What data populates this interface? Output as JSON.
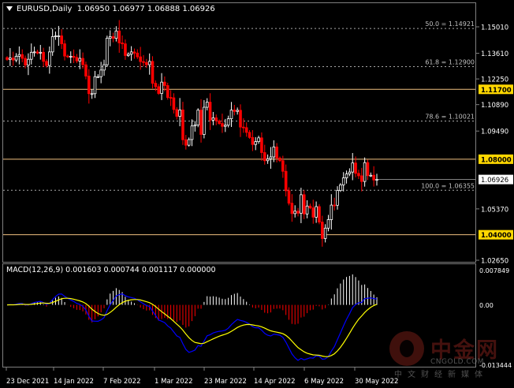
{
  "header": {
    "symbol": "EURUSD,Daily",
    "ohlc": "1.06950 1.06977 1.06888 1.06926"
  },
  "macd": {
    "title": "MACD(12,26,9) 0.001603 0.000744 0.001117 0.000000",
    "axis_labels": [
      "0.007849",
      "0.00",
      "-0.013444"
    ]
  },
  "price_axis": {
    "labels": [
      "1.15010",
      "1.13610",
      "1.12250",
      "1.10890",
      "1.09490",
      "1.05370",
      "1.02650"
    ],
    "current_price": "1.06926",
    "level_tags": [
      "1.11700",
      "1.08000",
      "1.04000"
    ]
  },
  "fib_levels": [
    {
      "label": "50.0 = 1.14921",
      "value": 1.14921
    },
    {
      "label": "61.8 = 1.12900",
      "value": 1.129
    },
    {
      "label": "78.6 = 1.10021",
      "value": 1.10021
    },
    {
      "label": "100.0 = 1.06355",
      "value": 1.06355
    }
  ],
  "horizontal_levels": [
    1.117,
    1.08,
    1.04
  ],
  "time_axis": [
    "23 Dec 2021",
    "14 Jan 2022",
    "7 Feb 2022",
    "1 Mar 2022",
    "23 Mar 2022",
    "14 Apr 2022",
    "6 May 2022",
    "30 May 2022"
  ],
  "colors": {
    "bull": "#ffffff",
    "bear": "#ff0000",
    "fib": "#a8a8a8",
    "level": "#f0c080",
    "signal": "#ffff00",
    "macd_line": "#0000ff",
    "hist_pos": "#ffffff",
    "hist_neg": "#ff0000",
    "tag_bg": "#ffd700"
  },
  "watermark": {
    "brand": "中金网",
    "domain": "CNGOLD.COM",
    "slogan": "中文财经新媒体"
  },
  "chart_data": {
    "type": "candlestick",
    "symbol": "EURUSD",
    "timeframe": "Daily",
    "closes": [
      1.1328,
      1.1336,
      1.1325,
      1.1345,
      1.1354,
      1.1334,
      1.1298,
      1.1329,
      1.1366,
      1.1368,
      1.1362,
      1.1366,
      1.1318,
      1.1296,
      1.1368,
      1.1449,
      1.1453,
      1.1453,
      1.1411,
      1.1346,
      1.1343,
      1.1345,
      1.1339,
      1.132,
      1.1334,
      1.13,
      1.124,
      1.1147,
      1.1147,
      1.1237,
      1.1237,
      1.1272,
      1.13,
      1.1441,
      1.1449,
      1.144,
      1.1479,
      1.1416,
      1.1411,
      1.1349,
      1.1356,
      1.1368,
      1.1362,
      1.1342,
      1.1317,
      1.1312,
      1.13,
      1.1318,
      1.1202,
      1.1184,
      1.1148,
      1.1208,
      1.119,
      1.1127,
      1.1125,
      1.1063,
      1.1027,
      1.1061,
      1.0903,
      1.0874,
      1.0904,
      1.0976,
      1.0981,
      1.106,
      1.0931,
      1.1075,
      1.1102,
      1.1007,
      1.1019,
      1.1003,
      1.0989,
      1.0974,
      1.098,
      1.1014,
      1.106,
      1.1053,
      1.1059,
      1.097,
      1.0967,
      1.0942,
      1.0915,
      1.0878,
      1.0893,
      1.0913,
      1.0835,
      1.0792,
      1.0802,
      1.0812,
      1.0865,
      1.0806,
      1.0792,
      1.0736,
      1.0633,
      1.0567,
      1.0512,
      1.0525,
      1.0514,
      1.0612,
      1.051,
      1.0552,
      1.0542,
      1.0493,
      1.0549,
      1.0467,
      1.038,
      1.0435,
      1.048,
      1.0557,
      1.0556,
      1.0634,
      1.0664,
      1.0701,
      1.0722,
      1.0732,
      1.078,
      1.0725,
      1.0712,
      1.0682,
      1.0782,
      1.0713,
      1.0715,
      1.069,
      1.0693
    ],
    "levels": {
      "fib_50": 1.14921,
      "fib_61_8": 1.129,
      "fib_78_6": 1.10021,
      "fib_100": 1.06355,
      "resistance_1": 1.117,
      "resistance_2": 1.08,
      "support": 1.04
    },
    "yrange": [
      1.0202,
      1.1553
    ],
    "macd_range": [
      -0.013444,
      0.007849
    ]
  }
}
